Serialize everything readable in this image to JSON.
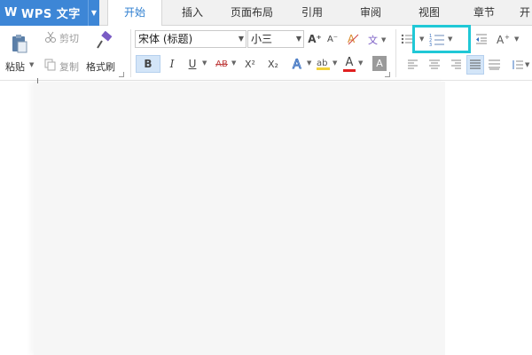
{
  "app": {
    "logo": "W",
    "name": "WPS 文字"
  },
  "tabs": [
    {
      "label": "开始",
      "active": true
    },
    {
      "label": "插入",
      "active": false
    },
    {
      "label": "页面布局",
      "active": false
    },
    {
      "label": "引用",
      "active": false
    },
    {
      "label": "审阅",
      "active": false
    },
    {
      "label": "视图",
      "active": false
    },
    {
      "label": "章节",
      "active": false
    },
    {
      "label": "开",
      "active": false
    }
  ],
  "clipboard": {
    "paste_label": "粘贴",
    "cut_label": "剪切",
    "copy_label": "复制",
    "format_painter_label": "格式刷"
  },
  "font": {
    "family_value": "宋体 (标题)",
    "size_value": "小三",
    "grow_label": "A⁺",
    "shrink_label": "A⁻",
    "bold_label": "B",
    "italic_label": "I",
    "underline_label": "U",
    "strike_label": "AB",
    "superscript_label": "X²",
    "subscript_label": "X₂",
    "font_color_label": "A",
    "char_shading_label": "A"
  },
  "colors": {
    "app_button": "#3d86d6",
    "active_tab_text": "#2f7fd0",
    "highlight_box": "#20c8d6",
    "pressed_button": "#d3e5f8",
    "font_color_underline": "#e02020",
    "highlight_color": "#f2d23a"
  }
}
